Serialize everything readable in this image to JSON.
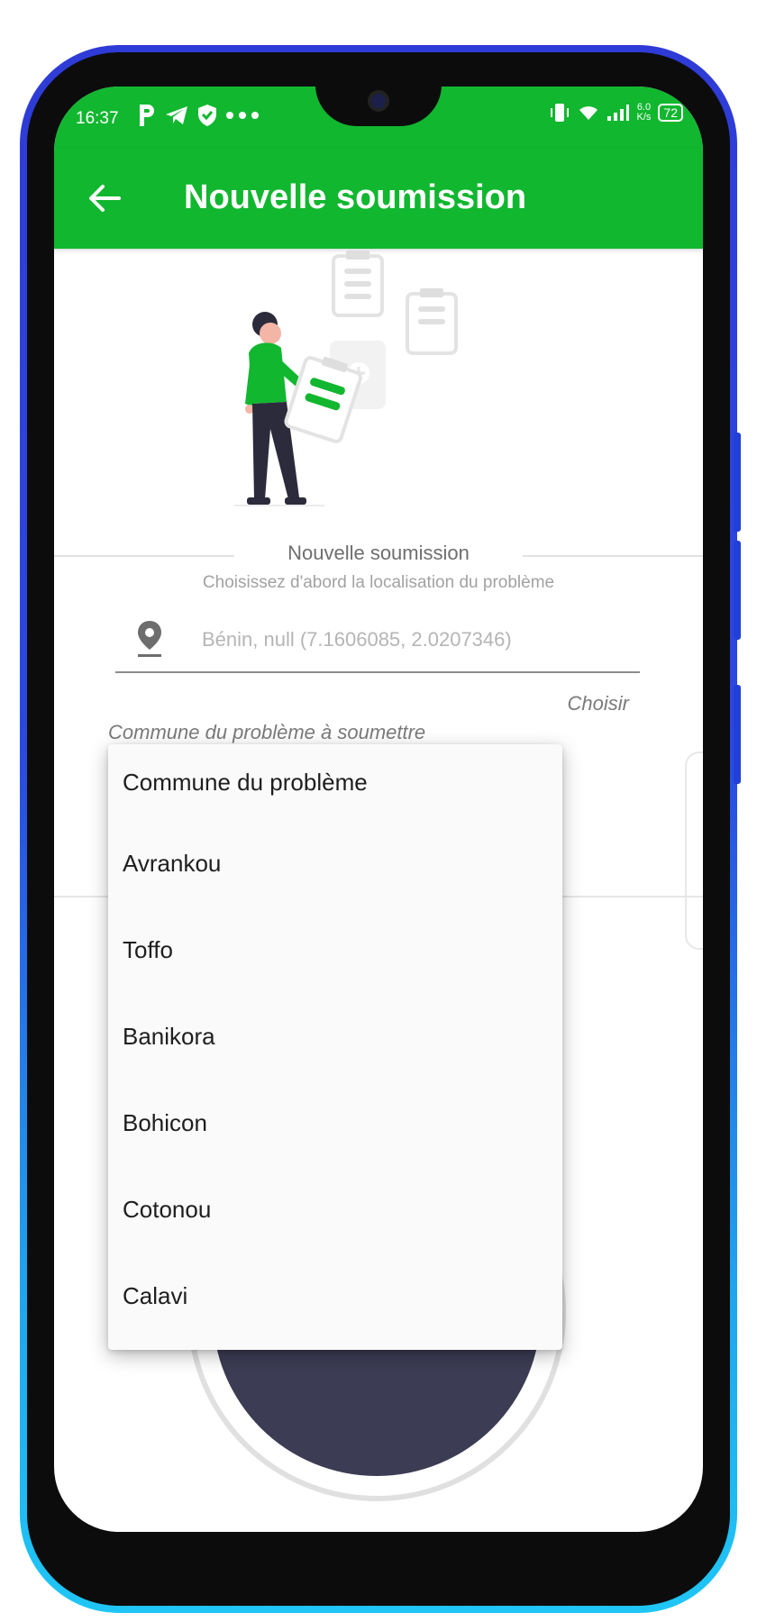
{
  "status_bar": {
    "time": "16:37",
    "netspeed_value": "6.0",
    "netspeed_unit": "K/s",
    "battery": "72"
  },
  "app_bar": {
    "title": "Nouvelle soumission"
  },
  "section": {
    "title": "Nouvelle soumission",
    "subtitle": "Choisissez d'abord la localisation du problème"
  },
  "location": {
    "value": "Bénin, null (7.1606085, 2.0207346)",
    "choose_label": "Choisir"
  },
  "commune": {
    "label": "Commune du problème à soumettre"
  },
  "dropdown": {
    "options": [
      "Commune du problème",
      "Avrankou",
      "Toffo",
      "Banikora",
      "Bohicon",
      "Cotonou",
      "Calavi"
    ]
  },
  "colors": {
    "brand_green": "#11b72f",
    "frame_blue_top": "#2f3bd6",
    "frame_blue_bottom": "#1fc6f5",
    "mic_dark": "#3c3c54"
  }
}
